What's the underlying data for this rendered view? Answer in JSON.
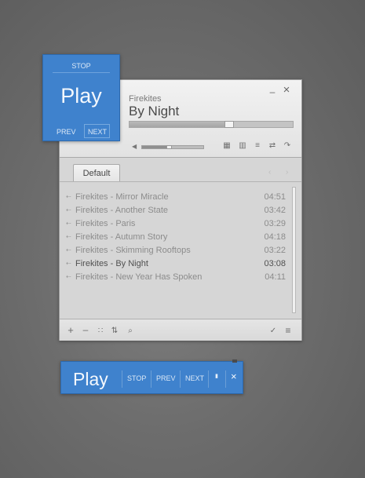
{
  "now_playing": {
    "artist": "Firekites",
    "title": "By Night",
    "seek_progress": 0.61,
    "volume": 0.43
  },
  "window_controls": {
    "minimize": "–",
    "close": "×"
  },
  "toolbar_icons": [
    "equalizer-icon",
    "visualizer-icon",
    "playlist-icon",
    "repeat-icon",
    "export-icon"
  ],
  "playlist": {
    "tab": "Default",
    "tracks": [
      {
        "name": "Firekites - Mirror Miracle",
        "duration": "04:51"
      },
      {
        "name": "Firekites - Another State",
        "duration": "03:42"
      },
      {
        "name": "Firekites - Paris",
        "duration": "03:29"
      },
      {
        "name": "Firekites - Autumn Story",
        "duration": "04:18"
      },
      {
        "name": "Firekites - Skimming Rooftops",
        "duration": "03:22"
      },
      {
        "name": "Firekites - By Night",
        "duration": "03:08",
        "active": true
      },
      {
        "name": "Firekites - New Year Has Spoken",
        "duration": "04:11"
      }
    ]
  },
  "footer_icons": {
    "add": "+",
    "remove": "–",
    "select_all": "∷",
    "sort": "⇅",
    "search": "⌕",
    "check": "✓",
    "menu": "≡"
  },
  "blue_widget": {
    "stop": "STOP",
    "play": "Play",
    "prev": "PREV",
    "next": "NEXT"
  },
  "blue_bar": {
    "play": "Play",
    "stop": "STOP",
    "prev": "PREV",
    "next": "NEXT",
    "mode_icon": "▮",
    "close": "×"
  },
  "colors": {
    "accent": "#3f82cd",
    "panel": "#d6d6d6",
    "active_track": "#505050"
  }
}
